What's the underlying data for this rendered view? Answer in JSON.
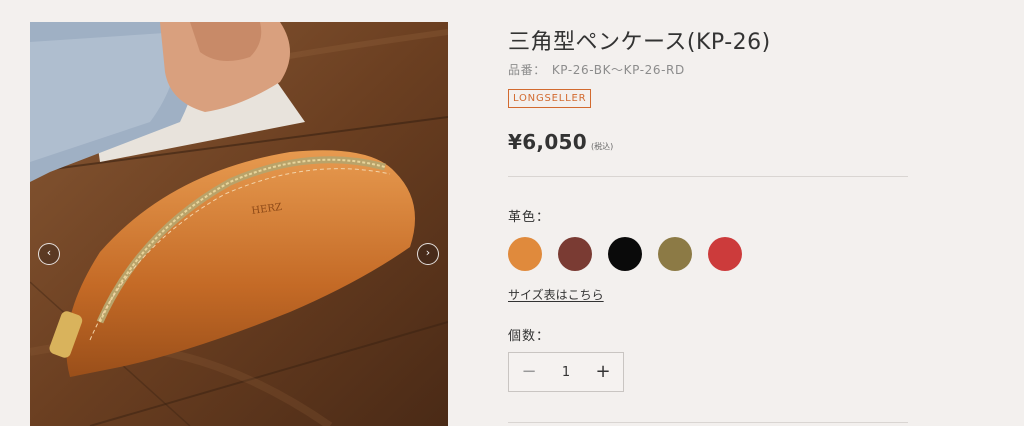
{
  "gallery": {
    "prev_icon": "chevron-left-icon",
    "next_icon": "chevron-right-icon",
    "prev_glyph": "‹",
    "next_glyph": "›"
  },
  "product": {
    "title": "三角型ペンケース(KP-26)",
    "sku_label": "品番：",
    "sku_value": "KP-26-BK〜KP-26-RD",
    "badge": "LONGSELLER",
    "price": "¥6,050",
    "tax_note": "(税込)"
  },
  "colors": {
    "label": "革色：",
    "swatches": [
      {
        "hex": "#e08a3c"
      },
      {
        "hex": "#7a3b33"
      },
      {
        "hex": "#0a0a0a"
      },
      {
        "hex": "#8c7a45"
      },
      {
        "hex": "#cc3b3b"
      }
    ]
  },
  "size_link": "サイズ表はこちら",
  "quantity": {
    "label": "個数：",
    "value": "1",
    "minus": "−",
    "plus": "+"
  }
}
